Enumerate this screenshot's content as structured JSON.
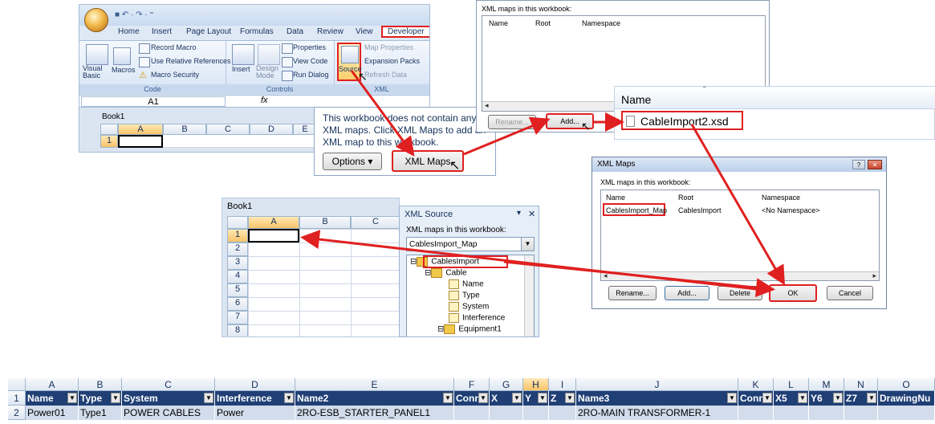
{
  "ribbon": {
    "tabs": [
      "Home",
      "Insert",
      "Page Layout",
      "Formulas",
      "Data",
      "Review",
      "View",
      "Developer"
    ],
    "code": {
      "visual_basic": "Visual Basic",
      "macros": "Macros",
      "record_macro": "Record Macro",
      "relative_refs": "Use Relative References",
      "macro_security": "Macro Security",
      "label": "Code"
    },
    "controls": {
      "insert": "Insert",
      "design_mode": "Design Mode",
      "properties": "Properties",
      "view_code": "View Code",
      "run_dialog": "Run Dialog",
      "label": "Controls"
    },
    "xml": {
      "source": "Source",
      "map_properties": "Map Properties",
      "expansion_packs": "Expansion Packs",
      "refresh_data": "Refresh Data",
      "label": "XML"
    }
  },
  "formula_bar": {
    "name_box": "A1",
    "fx": "fx"
  },
  "book_top": {
    "title": "Book1",
    "cols": [
      "A",
      "B",
      "C",
      "D",
      "E"
    ],
    "row": "1"
  },
  "info_popup": {
    "message": "This workbook does not contain any XML maps. Click XML Maps to add an XML map to this workbook.",
    "options_button": "Options ▾",
    "xml_maps_button": "XML Maps"
  },
  "dialog_top": {
    "label": "XML maps in this workbook:",
    "headers": [
      "Name",
      "Root",
      "Namespace"
    ],
    "rename": "Rename...",
    "add": "Add..."
  },
  "file_picker": {
    "header": "Name",
    "file": "CableImport2.xsd"
  },
  "xml_maps_dialog": {
    "title": "XML Maps",
    "label": "XML maps in this workbook:",
    "headers": [
      "Name",
      "Root",
      "Namespace"
    ],
    "row": {
      "name": "CablesImport_Map",
      "root": "CablesImport",
      "namespace": "<No Namespace>"
    },
    "buttons": {
      "rename": "Rename...",
      "add": "Add...",
      "delete": "Delete",
      "ok": "OK",
      "cancel": "Cancel"
    }
  },
  "book_mid": {
    "title": "Book1",
    "cols": [
      "A",
      "B",
      "C"
    ],
    "rows": [
      "1",
      "2",
      "3",
      "4",
      "5",
      "6",
      "7",
      "8"
    ]
  },
  "xml_source": {
    "title": "XML Source",
    "label": "XML maps in this workbook:",
    "selected_map": "CablesImport_Map",
    "tree": [
      "CablesImport",
      "Cable",
      "Name",
      "Type",
      "System",
      "Interference",
      "Equipment1"
    ]
  },
  "bottom_sheet": {
    "cols": [
      "A",
      "B",
      "C",
      "D",
      "E",
      "F",
      "G",
      "H",
      "I",
      "J",
      "K",
      "L",
      "M",
      "N",
      "O"
    ],
    "headers": [
      "Name",
      "Type",
      "System",
      "Interference",
      "Name2",
      "Conn",
      "X",
      "Y",
      "Z",
      "Name3",
      "Conn",
      "X5",
      "Y6",
      "Z7",
      "DrawingNu"
    ],
    "row2": [
      "Power01",
      "Type1",
      "POWER CABLES",
      "Power",
      "2RO-ESB_STARTER_PANEL1",
      "",
      "",
      "",
      "",
      "2RO-MAIN TRANSFORMER-1",
      "",
      "",
      "",
      "",
      ""
    ]
  },
  "colors": {
    "accent_red": "#e02020",
    "header_blue": "#1f3f75",
    "row_band": "#d2dceb"
  }
}
